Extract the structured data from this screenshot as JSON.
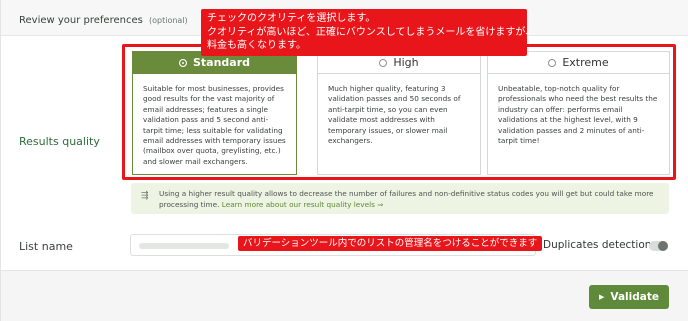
{
  "preferences": {
    "title": "Review your preferences",
    "optional": "(optional)"
  },
  "annotation_top": {
    "lines": [
      "チェックのクオリティを選択します。",
      "クオリティが高いほど、正確にバウンスしてしまうメールを省けますが、",
      "料金も高くなります。"
    ]
  },
  "results_quality": {
    "label": "Results quality",
    "options": [
      {
        "name": "Standard",
        "selected": true,
        "description": "Suitable for most businesses, provides good results for the vast majority of email addresses; features a single validation pass and 5 second anti-tarpit time; less suitable for validating email addresses with temporary issues (mailbox over quota, greylisting, etc.) and slower mail exchangers."
      },
      {
        "name": "High",
        "selected": false,
        "description": "Much higher quality, featuring 3 validation passes and 50 seconds of anti-tarpit time, so you can even validate most addresses with temporary issues, or slower mail exchangers."
      },
      {
        "name": "Extreme",
        "selected": false,
        "description": "Unbeatable, top-notch quality for professionals who need the best results the industry can offer: performs email validations at the highest level, with 9 validation passes and 2 minutes of anti-tarpit time!"
      }
    ]
  },
  "info": {
    "text": "Using a higher result quality allows to decrease the number of failures and non-definitive status codes you will get but could take more processing time.",
    "link": "Learn more about our result quality levels ⇒"
  },
  "list_name": {
    "label": "List name",
    "annotation": "バリデーションツール内でのリストの管理名をつけることができます"
  },
  "duplicates": {
    "label": "Duplicates detection",
    "enabled": false
  },
  "actions": {
    "validate_label": "Validate"
  },
  "colors": {
    "accent_green": "#6a8a3c",
    "annotation_red": "#e8161b",
    "info_bg": "#eef4e4"
  }
}
